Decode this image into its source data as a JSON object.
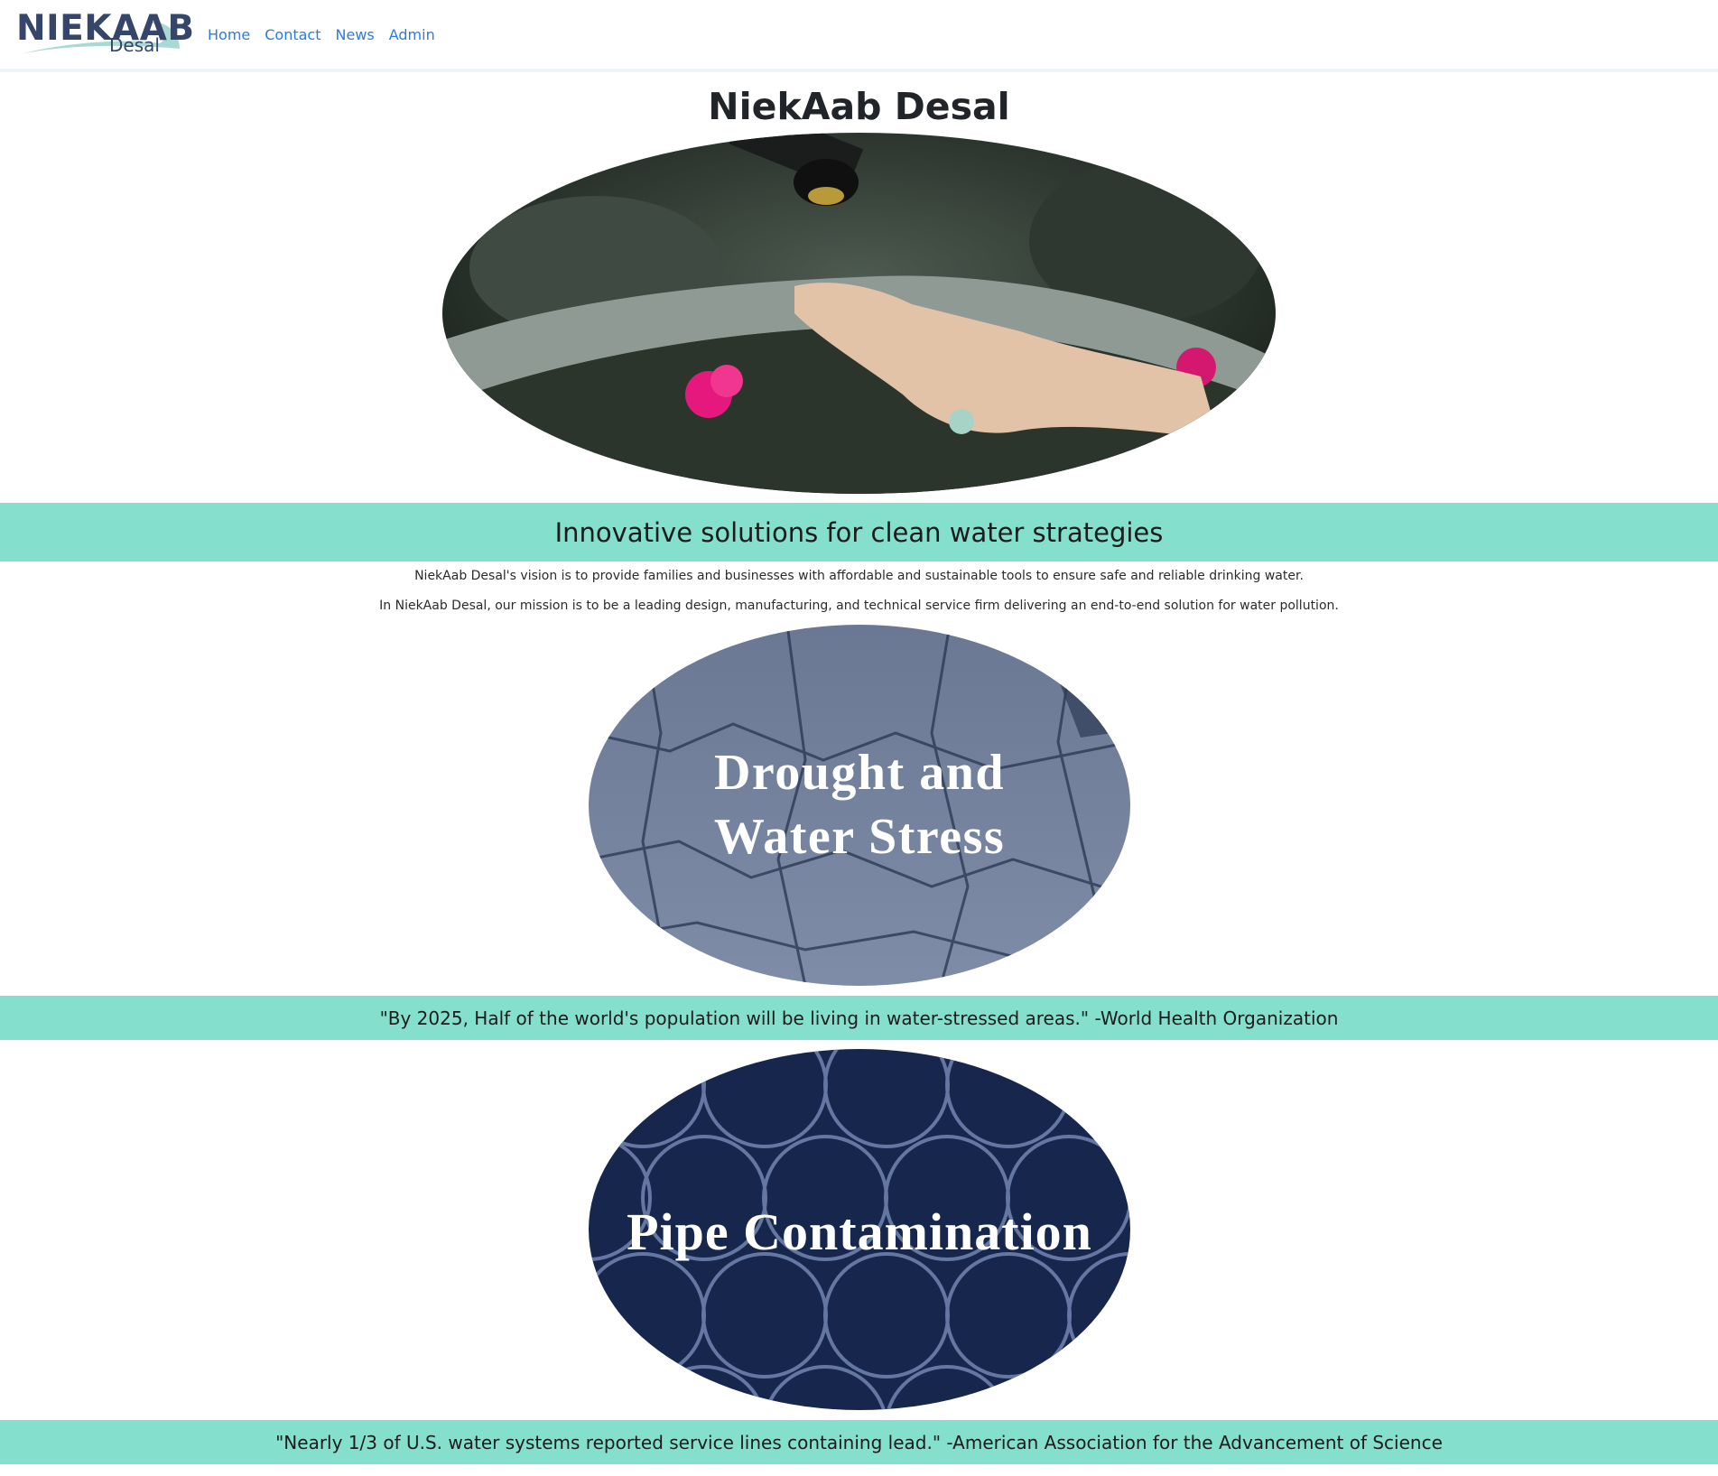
{
  "brand": {
    "logo_main": "NIEKAAB",
    "logo_sub": "Desal"
  },
  "nav": {
    "items": [
      {
        "label": "Home"
      },
      {
        "label": "Contact"
      },
      {
        "label": "News"
      },
      {
        "label": "Admin"
      }
    ]
  },
  "page": {
    "title": "NiekAab Desal"
  },
  "tagline": "Innovative solutions for clean water strategies",
  "vision": {
    "line1": "NiekAab Desal's vision is to provide families and businesses with affordable and sustainable tools to ensure safe and reliable drinking water.",
    "line2": "In NiekAab Desal, our mission is to be a leading design, manufacturing, and technical service firm delivering an end-to-end solution for water pollution."
  },
  "cards": [
    {
      "heading_line1": "Drought and",
      "heading_line2": "Water Stress",
      "quote": "\"By 2025, Half of the world's population will be living in water-stressed areas.\" -World Health Organization"
    },
    {
      "heading": "Pipe Contamination",
      "quote": "\"Nearly 1/3 of U.S. water systems reported service lines containing lead.\" -American Association for the Advancement of Science"
    }
  ],
  "colors": {
    "accent_band": "#84dfcc",
    "nav_link": "#2a7be4",
    "logo": "#35466a"
  }
}
